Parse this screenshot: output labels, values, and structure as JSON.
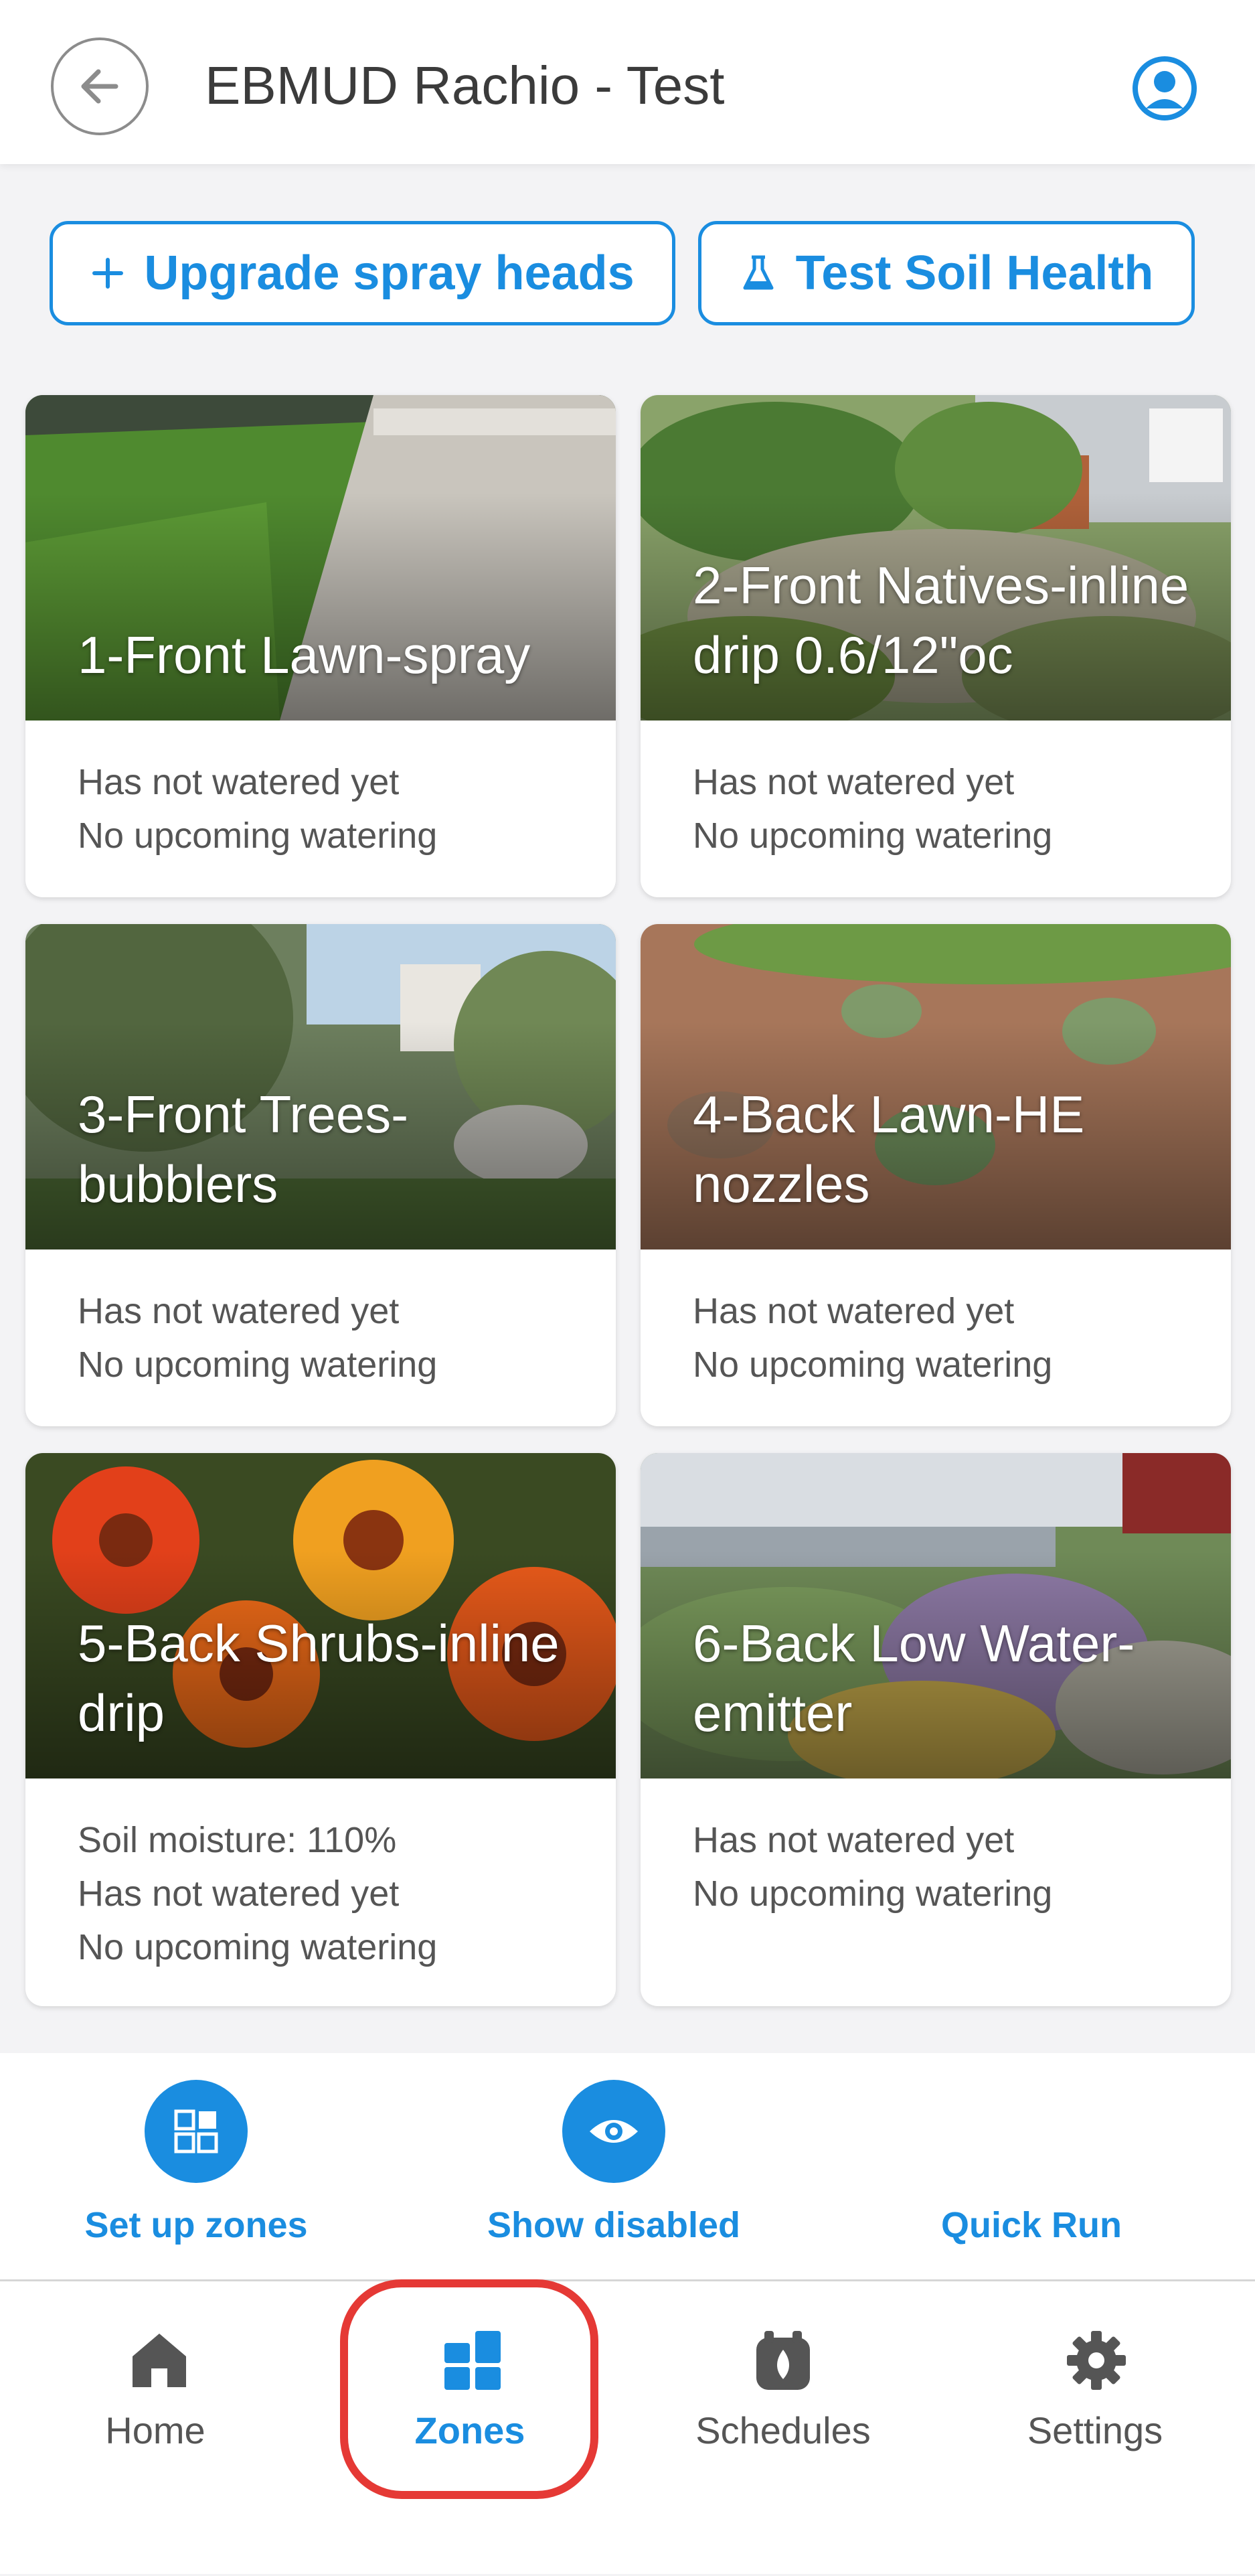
{
  "header": {
    "title": "EBMUD Rachio - Test",
    "back_icon": "arrow-left-icon",
    "profile_icon": "user-circle-icon"
  },
  "actions": {
    "upgrade_label": "Upgrade spray heads",
    "soil_label": "Test Soil Health"
  },
  "zones": [
    {
      "name": "1-Front Lawn-spray",
      "lines": [
        "Has not watered yet",
        "No upcoming watering"
      ]
    },
    {
      "name": "2-Front Natives-inline drip 0.6/12\"oc",
      "lines": [
        "Has not watered yet",
        "No upcoming watering"
      ]
    },
    {
      "name": "3-Front Trees-bubblers",
      "lines": [
        "Has not watered yet",
        "No upcoming watering"
      ]
    },
    {
      "name": "4-Back Lawn-HE nozzles",
      "lines": [
        "Has not watered yet",
        "No upcoming watering"
      ]
    },
    {
      "name": "5-Back Shrubs-inline drip",
      "lines": [
        "Soil moisture: 110%",
        "Has not watered yet",
        "No upcoming watering"
      ]
    },
    {
      "name": "6-Back Low Water-emitter",
      "lines": [
        "Has not watered yet",
        "No upcoming watering"
      ]
    }
  ],
  "zone_actions": {
    "setup_label": "Set up zones",
    "show_disabled_label": "Show disabled",
    "quick_run_label": "Quick Run"
  },
  "nav": {
    "home": "Home",
    "zones": "Zones",
    "schedules": "Schedules",
    "settings": "Settings",
    "active": "Zones"
  },
  "colors": {
    "accent": "#1a8de0",
    "highlight": "#e53935"
  }
}
